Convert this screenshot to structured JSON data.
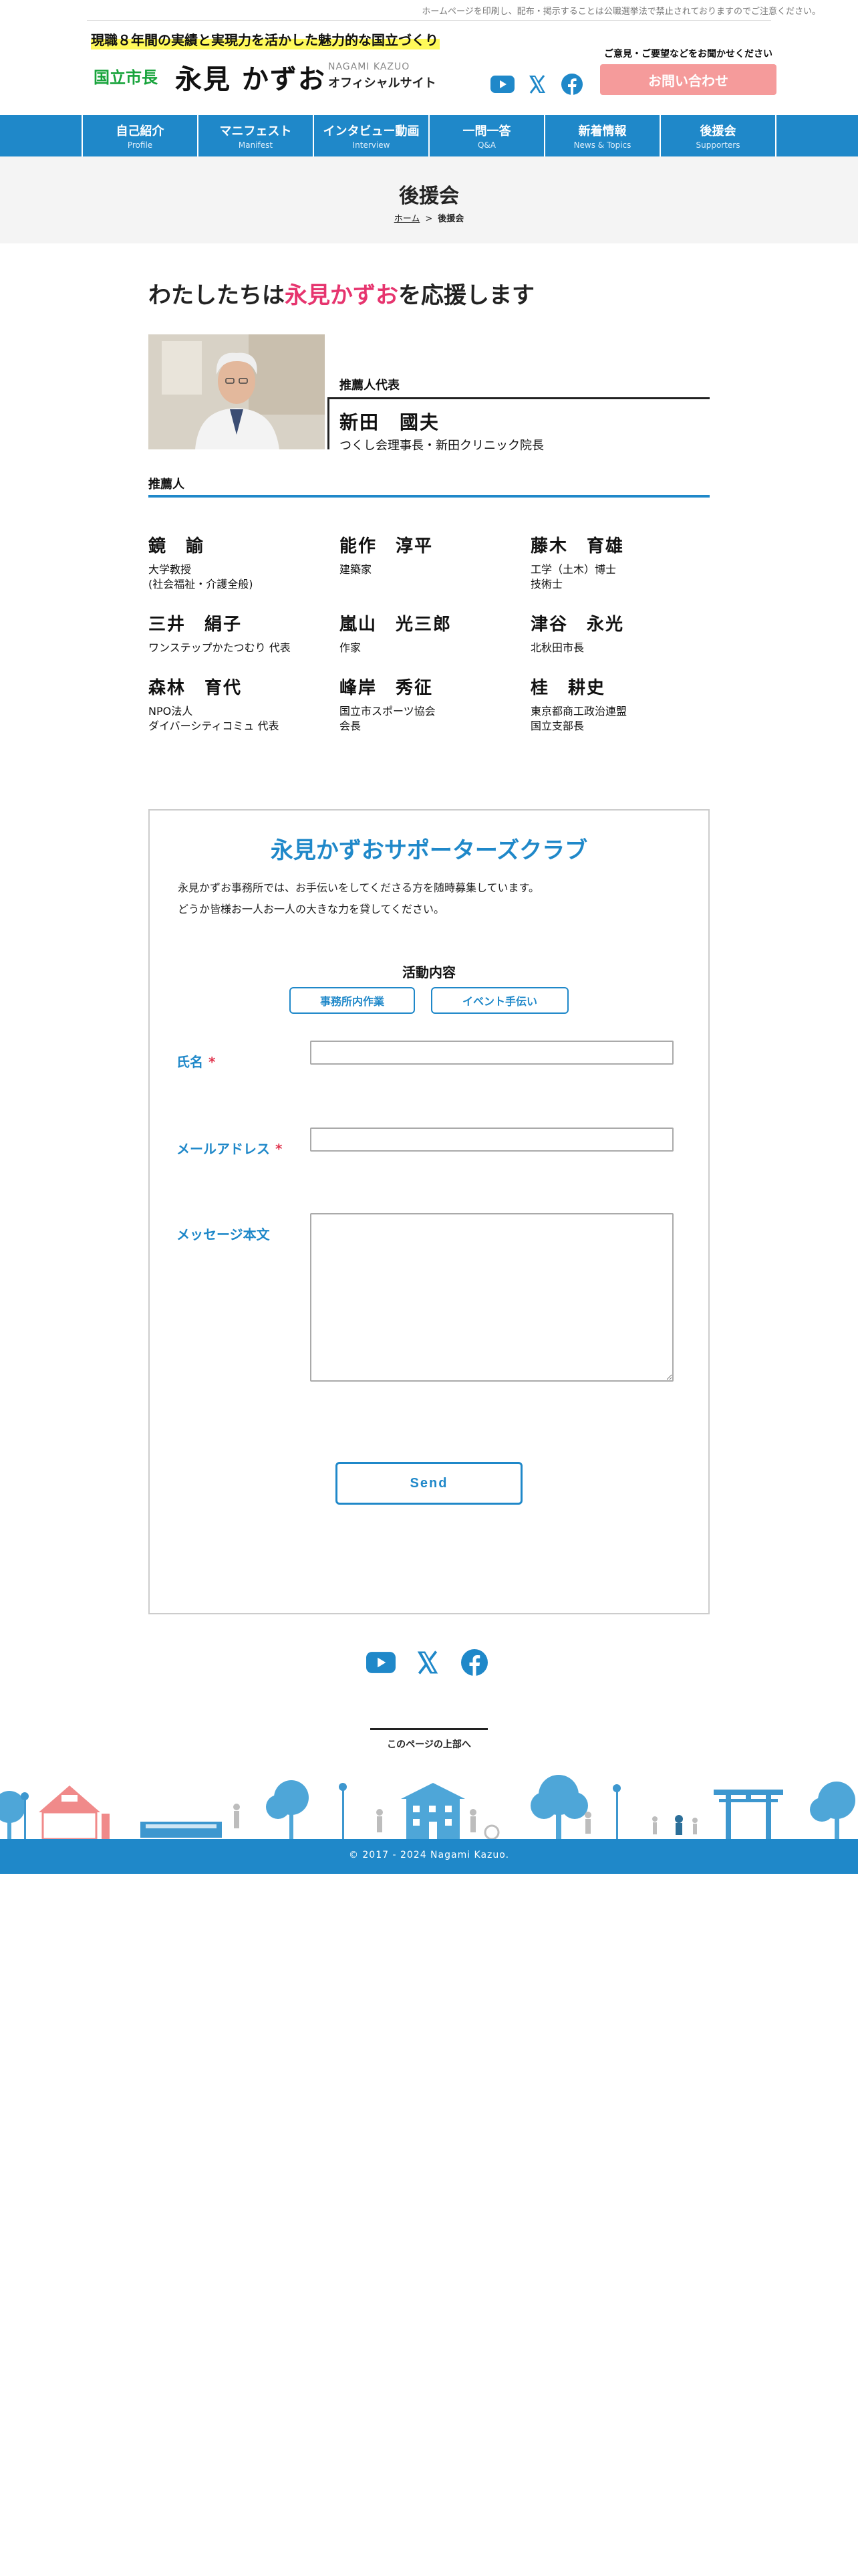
{
  "top_notice": "ホームページを印刷し、配布・掲示することは公職選挙法で禁止されておりますのでご注意ください。",
  "header": {
    "tagline": "現職８年間の実績と実現力を活かした魅力的な国立づくり",
    "mayor_title": "国立市長",
    "mayor_name": "永見 かずお",
    "name_roman": "NAGAMI KAZUO",
    "official_site": "オフィシャルサイト",
    "contact_label": "ご意見・ご要望などをお聞かせください",
    "contact_button": "お問い合わせ"
  },
  "nav": [
    {
      "jp": "自己紹介",
      "en": "Profile"
    },
    {
      "jp": "マニフェスト",
      "en": "Manifest"
    },
    {
      "jp": "インタビュー動画",
      "en": "Interview"
    },
    {
      "jp": "一問一答",
      "en": "Q&A"
    },
    {
      "jp": "新着情報",
      "en": "News & Topics"
    },
    {
      "jp": "後援会",
      "en": "Supporters"
    }
  ],
  "page": {
    "title": "後援会",
    "breadcrumb_home": "ホーム",
    "breadcrumb_sep": ">",
    "breadcrumb_current": "後援会"
  },
  "support": {
    "heading_pre": "わたしたちは",
    "heading_name": "永見かずお",
    "heading_post": "を応援します",
    "rep_label": "推薦人代表",
    "rep_name": "新田　國夫",
    "rep_role": "つくし会理事長・新田クリニック院長",
    "supporters_label": "推薦人",
    "supporters": [
      {
        "name": "鏡　諭",
        "role": "大学教授\n(社会福祉・介護全般)"
      },
      {
        "name": "能作　淳平",
        "role": "建築家"
      },
      {
        "name": "藤木　育雄",
        "role": "工学（土木）博士\n技術士"
      },
      {
        "name": "三井　絹子",
        "role": "ワンステップかたつむり 代表"
      },
      {
        "name": "嵐山　光三郎",
        "role": "作家"
      },
      {
        "name": "津谷　永光",
        "role": "北秋田市長"
      },
      {
        "name": "森林　育代",
        "role": "NPO法人\nダイバーシティコミュ 代表"
      },
      {
        "name": "峰岸　秀征",
        "role": "国立市スポーツ協会\n会長"
      },
      {
        "name": "桂　耕史",
        "role": "東京都商工政治連盟\n国立支部長"
      }
    ]
  },
  "club": {
    "title": "永見かずおサポーターズクラブ",
    "desc_line1": "永見かずお事務所では、お手伝いをしてくださる方を随時募集しています。",
    "desc_line2": "どうか皆様お一人お一人の大きな力を貸してください。",
    "activity_label": "活動内容",
    "activity_1": "事務所内作業",
    "activity_2": "イベント手伝い",
    "name_label": "氏名",
    "email_label": "メールアドレス",
    "message_label": "メッセージ本文",
    "required_mark": "*",
    "name_value": "",
    "email_value": "",
    "message_value": "",
    "send_button": "Send"
  },
  "footer": {
    "page_top": "このページの上部へ",
    "copyright": "© 2017 - 2024 Nagami Kazuo."
  },
  "colors": {
    "brand_blue": "#1f88c9",
    "highlight_pink": "#e6346e",
    "contact_pink": "#f59b9b",
    "mayor_green": "#17a33b",
    "tagline_yellow": "#fff95a",
    "required_red": "#e0304a"
  },
  "icons": [
    "youtube-icon",
    "x-icon",
    "facebook-icon"
  ]
}
